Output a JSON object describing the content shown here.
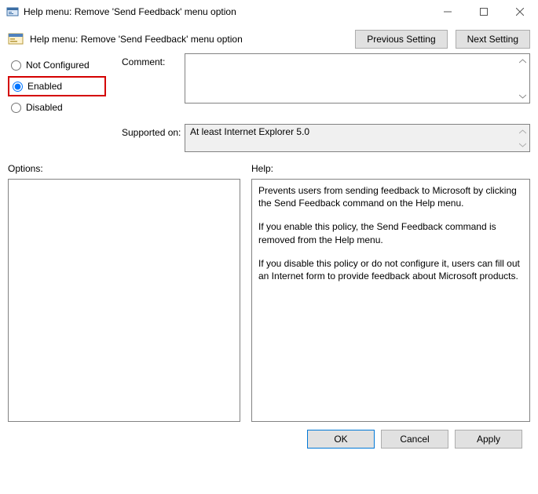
{
  "window": {
    "title": "Help menu: Remove 'Send Feedback' menu option"
  },
  "header": {
    "policy_name": "Help menu: Remove 'Send Feedback' menu option",
    "prev_btn": "Previous Setting",
    "next_btn": "Next Setting"
  },
  "state": {
    "not_configured": "Not Configured",
    "enabled": "Enabled",
    "disabled": "Disabled",
    "selected": "enabled"
  },
  "labels": {
    "comment": "Comment:",
    "supported": "Supported on:",
    "options": "Options:",
    "help": "Help:"
  },
  "fields": {
    "comment": "",
    "supported_on": "At least Internet Explorer 5.0"
  },
  "help": {
    "p1": "Prevents users from sending feedback to Microsoft by clicking the Send Feedback command on the Help menu.",
    "p2": "If you enable this policy, the Send Feedback command is removed from the Help menu.",
    "p3": "If you disable this policy or do not configure it, users can fill out an Internet form to provide feedback about Microsoft products."
  },
  "footer": {
    "ok": "OK",
    "cancel": "Cancel",
    "apply": "Apply"
  }
}
